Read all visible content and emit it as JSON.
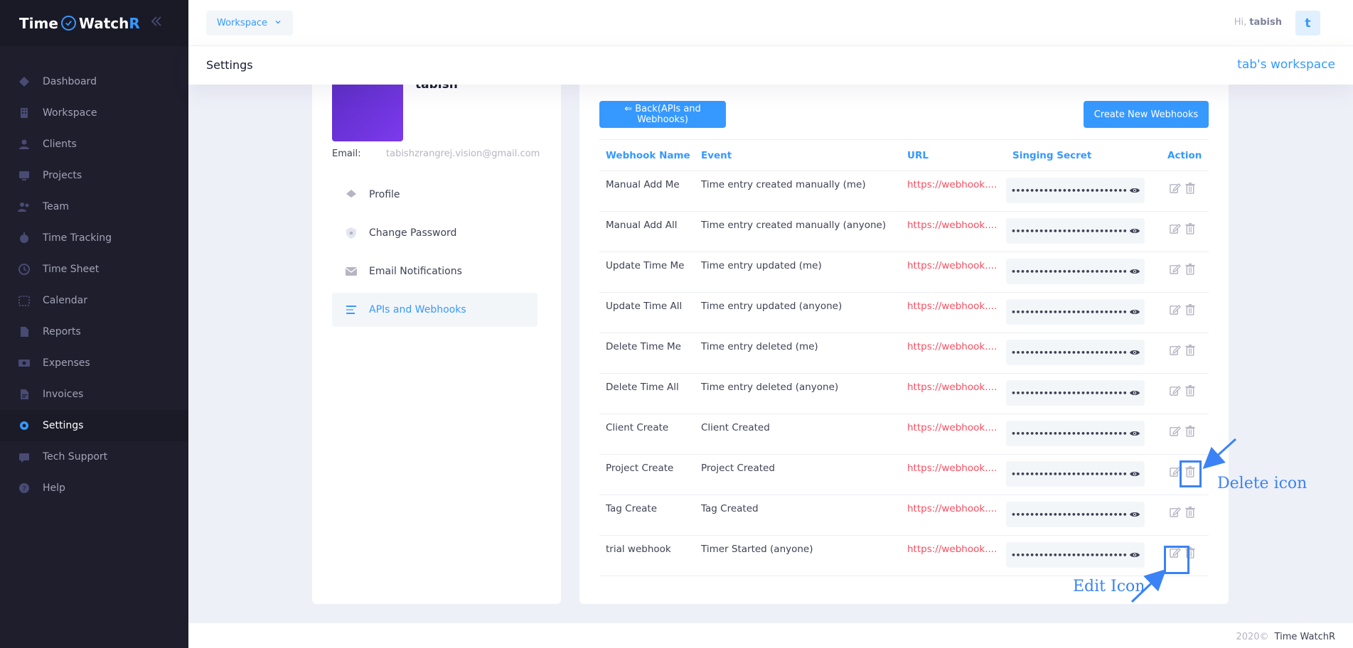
{
  "brand": {
    "name_part1": "Time",
    "name_part2": "Watch",
    "name_part3": "R"
  },
  "sidebar": {
    "items": [
      {
        "label": "Dashboard",
        "icon": "dashboard-icon"
      },
      {
        "label": "Workspace",
        "icon": "building-icon"
      },
      {
        "label": "Clients",
        "icon": "user-icon"
      },
      {
        "label": "Projects",
        "icon": "monitor-icon"
      },
      {
        "label": "Team",
        "icon": "users-icon"
      },
      {
        "label": "Time Tracking",
        "icon": "stopwatch-icon"
      },
      {
        "label": "Time Sheet",
        "icon": "clock-icon"
      },
      {
        "label": "Calendar",
        "icon": "calendar-icon"
      },
      {
        "label": "Reports",
        "icon": "document-icon"
      },
      {
        "label": "Expenses",
        "icon": "money-icon"
      },
      {
        "label": "Invoices",
        "icon": "invoice-icon"
      },
      {
        "label": "Settings",
        "icon": "gear-icon",
        "active": true
      },
      {
        "label": "Tech Support",
        "icon": "support-icon"
      },
      {
        "label": "Help",
        "icon": "help-icon"
      }
    ]
  },
  "header": {
    "workspace_button": "Workspace",
    "greeting": "Hi,",
    "user_name": "tabish",
    "avatar_letter": "t"
  },
  "subheader": {
    "title": "Settings",
    "workspace_name": "tab's workspace"
  },
  "profile": {
    "name": "tabish",
    "email_label": "Email:",
    "email_value": "tabishzrangrej.vision@gmail.com",
    "menu": [
      {
        "label": "Profile",
        "icon": "layers-icon"
      },
      {
        "label": "Change Password",
        "icon": "shield-icon"
      },
      {
        "label": "Email Notifications",
        "icon": "mail-icon"
      },
      {
        "label": "APIs and Webhooks",
        "icon": "list-icon",
        "active": true
      }
    ]
  },
  "webhooks": {
    "back_button": "⇐ Back(APIs and Webhooks)",
    "create_button": "Create New Webhooks",
    "columns": [
      "Webhook Name",
      "Event",
      "URL",
      "Singing Secret",
      "Action"
    ],
    "rows": [
      {
        "name": "Manual Add Me",
        "event": "Time entry created manually (me)",
        "url": "https://webhook...."
      },
      {
        "name": "Manual Add All",
        "event": "Time entry created manually (anyone)",
        "url": "https://webhook...."
      },
      {
        "name": "Update Time Me",
        "event": "Time entry updated (me)",
        "url": "https://webhook...."
      },
      {
        "name": "Update Time All",
        "event": "Time entry updated (anyone)",
        "url": "https://webhook...."
      },
      {
        "name": "Delete Time Me",
        "event": "Time entry deleted (me)",
        "url": "https://webhook...."
      },
      {
        "name": "Delete Time All",
        "event": "Time entry deleted (anyone)",
        "url": "https://webhook...."
      },
      {
        "name": "Client Create",
        "event": "Client Created",
        "url": "https://webhook...."
      },
      {
        "name": "Project Create",
        "event": "Project Created",
        "url": "https://webhook...."
      },
      {
        "name": "Tag Create",
        "event": "Tag Created",
        "url": "https://webhook...."
      },
      {
        "name": "trial webhook",
        "event": "Timer Started (anyone)",
        "url": "https://webhook...."
      }
    ],
    "secret_mask": "••••••••••••••••••••••••••••••••••••••"
  },
  "annotations": {
    "delete_label": "Delete icon",
    "edit_label": "Edit Icon"
  },
  "footer": {
    "year": "2020©",
    "brand": "Time WatchR"
  },
  "colors": {
    "accent": "#3699ff",
    "sidebar_bg": "#1e1e2d",
    "url_red": "#f64e60",
    "annotation_blue": "#3b82f6"
  }
}
